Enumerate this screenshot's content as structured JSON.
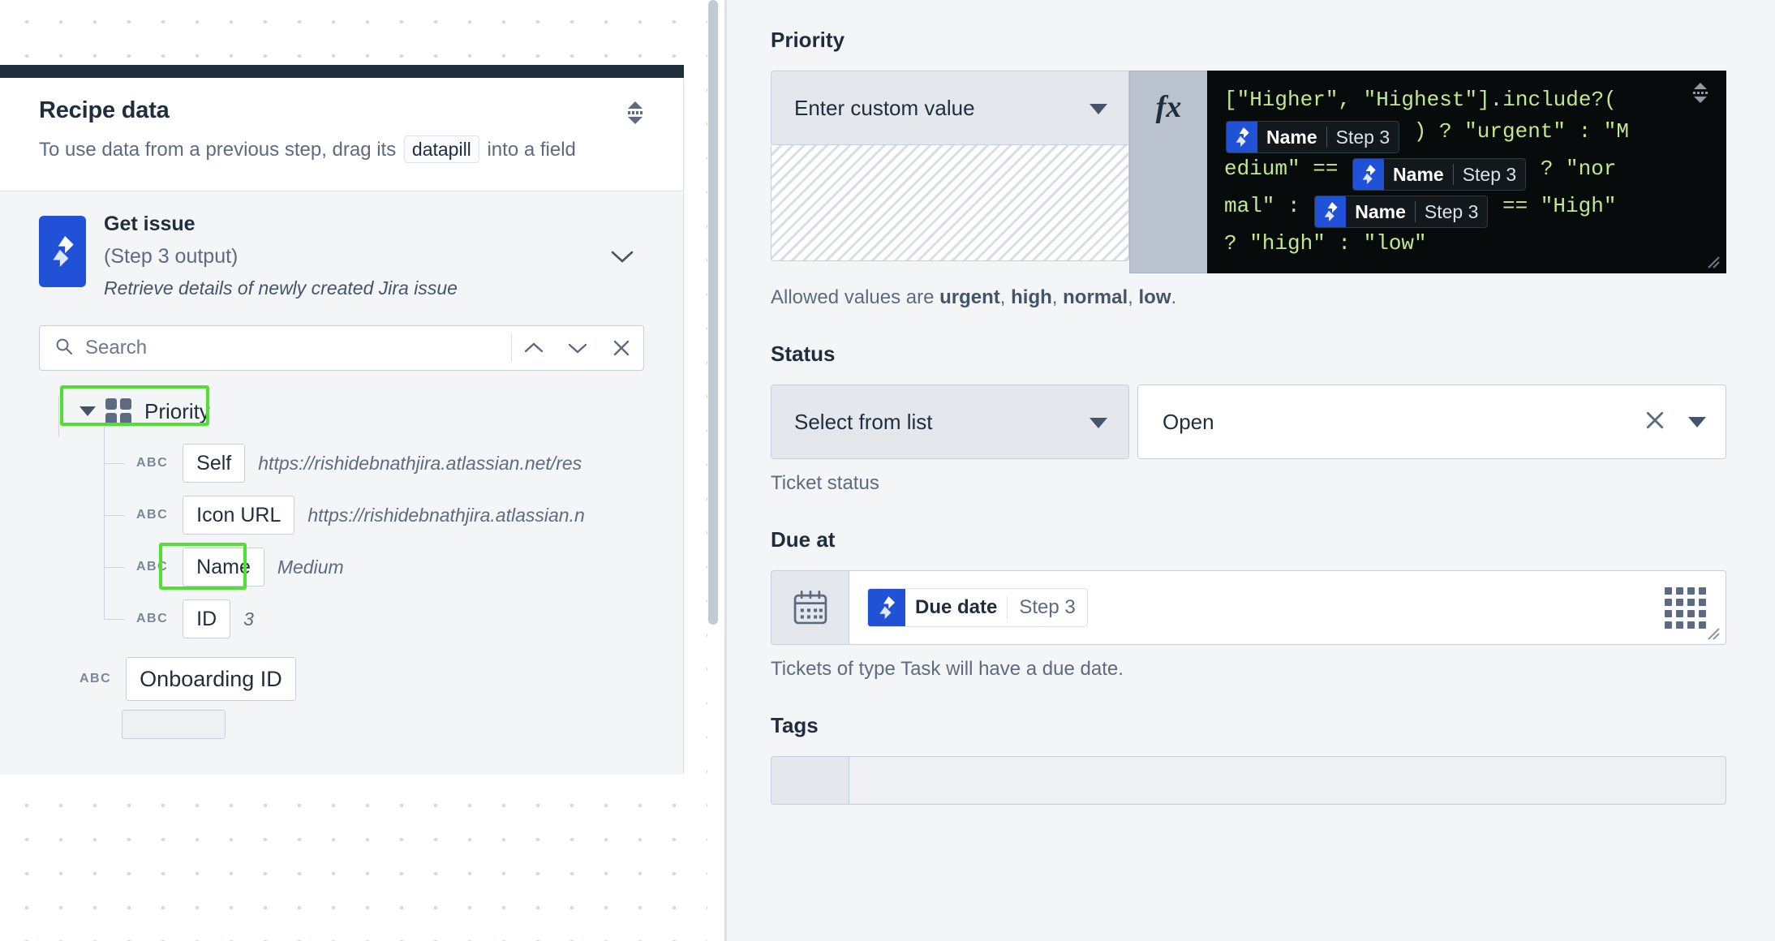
{
  "left_panel": {
    "title": "Recipe data",
    "description_before": "To use data from a previous step, drag its",
    "description_pill": "datapill",
    "description_after": "into a field",
    "drag_handle_icon": "drag-handle-vertical-icon",
    "step": {
      "name": "Get issue",
      "output": "(Step 3 output)",
      "description": "Retrieve details of newly created Jira issue",
      "app_icon": "jira-icon",
      "collapse_icon": "chevron-down-icon"
    },
    "search": {
      "placeholder": "Search",
      "value": "",
      "icon": "search-icon",
      "prev_icon": "chevron-up-icon",
      "next_icon": "chevron-down-icon",
      "clear_icon": "close-icon"
    },
    "tree": {
      "group": {
        "label": "Priority",
        "caret_icon": "caret-down-icon",
        "type_icon": "object-grid-icon",
        "highlighted": true
      },
      "children": [
        {
          "type": "ABC",
          "name": "Self",
          "value": "https://rishidebnathjira.atlassian.net/res",
          "highlighted": false
        },
        {
          "type": "ABC",
          "name": "Icon URL",
          "value": "https://rishidebnathjira.atlassian.n",
          "highlighted": false
        },
        {
          "type": "ABC",
          "name": "Name",
          "value": "Medium",
          "highlighted": true
        },
        {
          "type": "ABC",
          "name": "ID",
          "value": "3",
          "highlighted": false
        }
      ],
      "siblings": [
        {
          "type": "ABC",
          "name": "Onboarding ID",
          "value": "",
          "highlighted": false
        }
      ]
    },
    "highlight_color": "#4fe032"
  },
  "right_panel": {
    "priority": {
      "label": "Priority",
      "mode_select": "Enter custom value",
      "mode_caret_icon": "caret-down-icon",
      "formula_icon": "fx-icon",
      "formula": {
        "line1_code": "[\"Higher\", \"Highest\"].include?(",
        "pill1": {
          "name": "Name",
          "step": "Step 3",
          "icon": "jira-icon"
        },
        "line2_code": ") ? \"urgent\" :  \"M",
        "line3_prefix": "edium\" ==",
        "pill2": {
          "name": "Name",
          "step": "Step 3",
          "icon": "jira-icon"
        },
        "line3_suffix": "?  \"nor",
        "line4_prefix": "mal\" :",
        "pill3": {
          "name": "Name",
          "step": "Step 3",
          "icon": "jira-icon"
        },
        "line4_suffix": "== \"High\"",
        "line5": "?  \"high\" : \"low\"",
        "drag_icon": "drag-handle-vertical-icon",
        "resize_icon": "resize-corner-icon"
      },
      "help_prefix": "Allowed values are ",
      "help_values": [
        "urgent",
        "high",
        "normal",
        "low"
      ],
      "help_suffix": "."
    },
    "status": {
      "label": "Status",
      "mode_select": "Select from list",
      "mode_caret_icon": "caret-down-icon",
      "value": "Open",
      "clear_icon": "close-icon",
      "dropdown_icon": "caret-down-icon",
      "help": "Ticket status"
    },
    "due_at": {
      "label": "Due at",
      "calendar_icon": "calendar-icon",
      "pill": {
        "name": "Due date",
        "step": "Step 3",
        "icon": "jira-icon"
      },
      "datapill_picker_icon": "grid-dots-icon",
      "resize_icon": "resize-corner-icon",
      "help": "Tickets of type Task will have a due date."
    },
    "tags": {
      "label": "Tags"
    }
  },
  "colors": {
    "brand_blue": "#2051d6",
    "highlight_green": "#4fe032",
    "dark_header": "#1f2d3d",
    "code_bg": "#080b0c",
    "code_string": "#c3e88d"
  }
}
